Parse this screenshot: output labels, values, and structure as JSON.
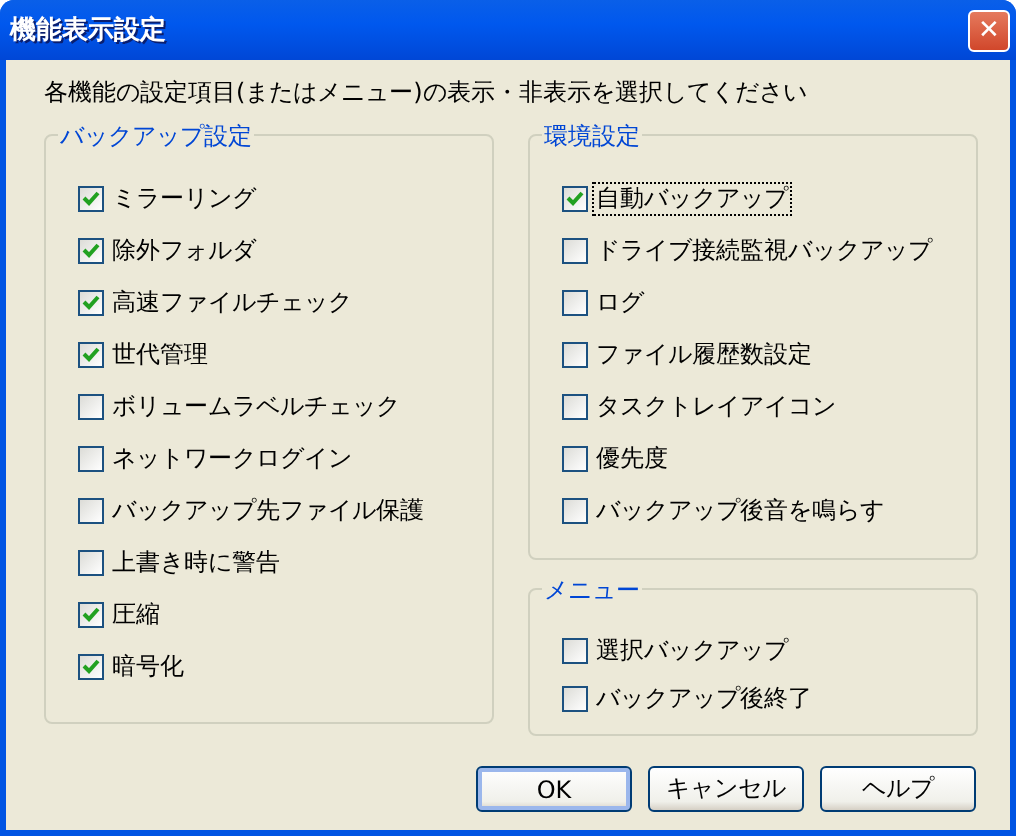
{
  "window": {
    "title": "機能表示設定",
    "close": "✕"
  },
  "instruction": "各機能の設定項目(またはメニュー)の表示・非表示を選択してください",
  "columns": [
    {
      "groups": [
        {
          "title": "バックアップ設定",
          "items": [
            {
              "label": "ミラーリング",
              "checked": true,
              "focused": false
            },
            {
              "label": "除外フォルダ",
              "checked": true,
              "focused": false
            },
            {
              "label": "高速ファイルチェック",
              "checked": true,
              "focused": false
            },
            {
              "label": "世代管理",
              "checked": true,
              "focused": false
            },
            {
              "label": "ボリュームラベルチェック",
              "checked": false,
              "focused": false
            },
            {
              "label": "ネットワークログイン",
              "checked": false,
              "focused": false
            },
            {
              "label": "バックアップ先ファイル保護",
              "checked": false,
              "focused": false
            },
            {
              "label": "上書き時に警告",
              "checked": false,
              "focused": false
            },
            {
              "label": "圧縮",
              "checked": true,
              "focused": false
            },
            {
              "label": "暗号化",
              "checked": true,
              "focused": false
            }
          ]
        }
      ]
    },
    {
      "groups": [
        {
          "title": "環境設定",
          "items": [
            {
              "label": "自動バックアップ",
              "checked": true,
              "focused": true
            },
            {
              "label": "ドライブ接続監視バックアップ",
              "checked": false,
              "focused": false
            },
            {
              "label": "ログ",
              "checked": false,
              "focused": false
            },
            {
              "label": "ファイル履歴数設定",
              "checked": false,
              "focused": false
            },
            {
              "label": "タスクトレイアイコン",
              "checked": false,
              "focused": false
            },
            {
              "label": "優先度",
              "checked": false,
              "focused": false
            },
            {
              "label": "バックアップ後音を鳴らす",
              "checked": false,
              "focused": false
            }
          ]
        },
        {
          "title": "メニュー",
          "items": [
            {
              "label": "選択バックアップ",
              "checked": false,
              "focused": false
            },
            {
              "label": "バックアップ後終了",
              "checked": false,
              "focused": false
            }
          ]
        }
      ]
    }
  ],
  "buttons": [
    {
      "label": "OK",
      "default": true
    },
    {
      "label": "キャンセル",
      "default": false
    },
    {
      "label": "ヘルプ",
      "default": false
    }
  ]
}
